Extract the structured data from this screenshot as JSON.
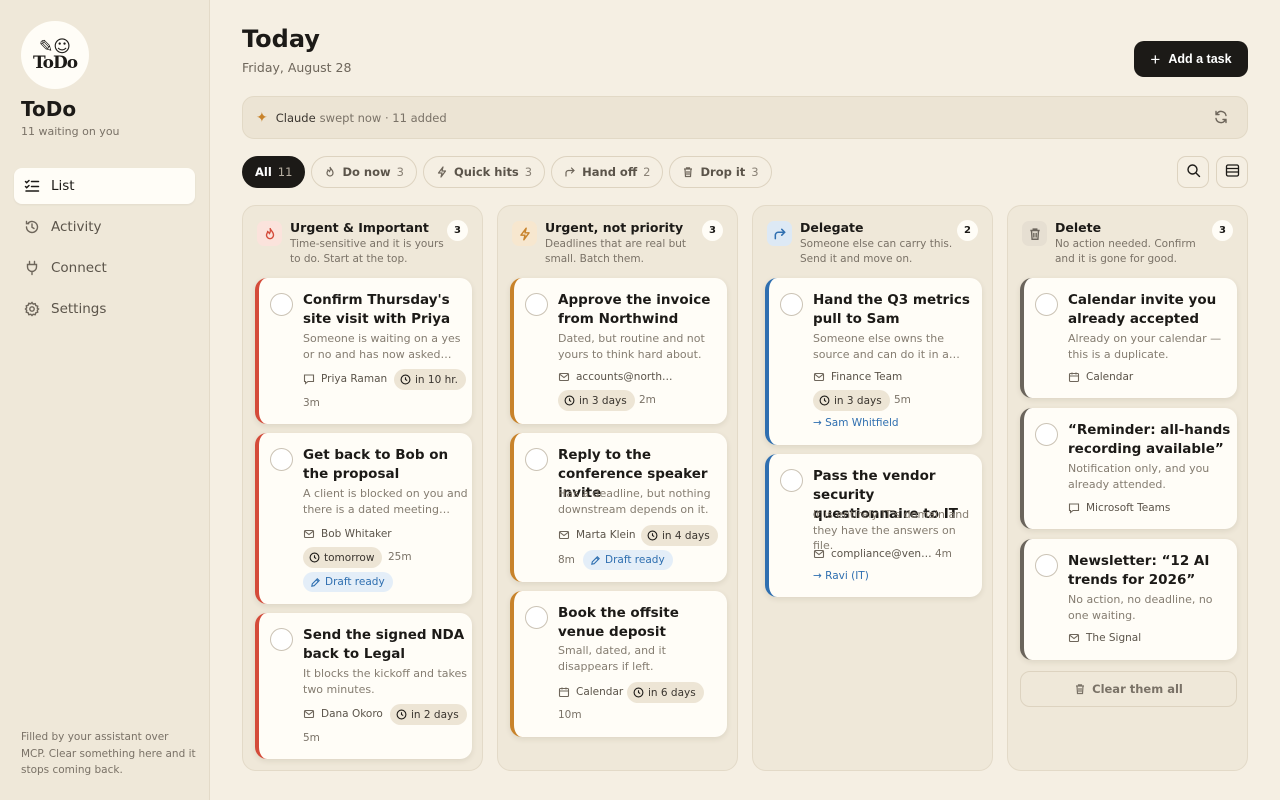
{
  "app": {
    "name": "ToDo",
    "subtitle": "11 waiting on you",
    "logo_text": "ToDo"
  },
  "nav": [
    {
      "label": "List",
      "icon": "list-check-icon",
      "active": true
    },
    {
      "label": "Activity",
      "icon": "history-icon",
      "active": false
    },
    {
      "label": "Connect",
      "icon": "plug-icon",
      "active": false
    },
    {
      "label": "Settings",
      "icon": "gear-icon",
      "active": false
    }
  ],
  "sidebar_footer": "Filled by your assistant over MCP. Clear something here and it stops coming back.",
  "header": {
    "title": "Today",
    "date": "Friday, August 28",
    "add_label": "Add a task"
  },
  "banner": {
    "who": "Claude",
    "text": "swept now · 11 added"
  },
  "filters": [
    {
      "label": "All",
      "count": "11",
      "active": true
    },
    {
      "label": "Do now",
      "count": "3",
      "icon": "flame-icon"
    },
    {
      "label": "Quick hits",
      "count": "3",
      "icon": "bolt-icon"
    },
    {
      "label": "Hand off",
      "count": "2",
      "icon": "forward-arrow-icon"
    },
    {
      "label": "Drop it",
      "count": "3",
      "icon": "trash-icon"
    }
  ],
  "columns": [
    {
      "title": "Urgent & Important",
      "count": "3",
      "accent": "#d44b3a",
      "desc": "Time-sensitive and it is yours to do. Start at the top.",
      "cards": [
        {
          "title": "Confirm Thursday's site visit with Priya",
          "desc": "Someone is waiting on a yes or no and has now asked…",
          "source": "Priya Raman",
          "source_icon": "chat-icon",
          "due": "in 10 hr.",
          "est": "3m"
        },
        {
          "title": "Get back to Bob on the proposal",
          "desc": "A client is blocked on you and there is a dated meeting…",
          "source": "Bob Whitaker",
          "source_icon": "mail-icon",
          "due": "tomorrow",
          "est": "25m",
          "draft": "Draft ready"
        },
        {
          "title": "Send the signed NDA back to Legal",
          "desc": "It blocks the kickoff and takes two minutes.",
          "source": "Dana Okoro",
          "source_icon": "mail-icon",
          "due": "in 2 days",
          "est": "5m"
        }
      ]
    },
    {
      "title": "Urgent, not priority",
      "count": "3",
      "accent": "#c8832b",
      "desc": "Deadlines that are real but small. Batch them.",
      "cards": [
        {
          "title": "Approve the invoice from Northwind",
          "desc": "Dated, but routine and not yours to think hard about.",
          "source": "accounts@north…",
          "source_icon": "mail-icon",
          "due": "in 3 days",
          "est": "2m"
        },
        {
          "title": "Reply to the conference speaker invite",
          "desc": "Has a deadline, but nothing downstream depends on it.",
          "source": "Marta Klein",
          "source_icon": "mail-icon",
          "due": "in 4 days",
          "est": "8m",
          "draft": "Draft ready"
        },
        {
          "title": "Book the offsite venue deposit",
          "desc": "Small, dated, and it disappears if left.",
          "source": "Calendar",
          "source_icon": "calendar-icon",
          "due": "in 6 days",
          "est": "10m"
        }
      ]
    },
    {
      "title": "Delegate",
      "count": "2",
      "accent": "#2f6fb0",
      "desc": "Someone else can carry this. Send it and move on.",
      "cards": [
        {
          "title": "Hand the Q3 metrics pull to Sam",
          "desc": "Someone else owns the source and can do it in a…",
          "source": "Finance Team",
          "source_icon": "mail-icon",
          "due": "in 3 days",
          "est": "5m",
          "assignee": "→ Sam Whitfield"
        },
        {
          "title": "Pass the vendor security questionnaire to IT",
          "desc": "It is entirely IT's domain and they have the answers on file.",
          "source": "compliance@ven…",
          "source_icon": "mail-icon",
          "est": "4m",
          "assignee": "→ Ravi (IT)"
        }
      ]
    },
    {
      "title": "Delete",
      "count": "3",
      "accent": "#6b655c",
      "desc": "No action needed. Confirm and it is gone for good.",
      "cards": [
        {
          "title": "Calendar invite you already accepted",
          "desc": "Already on your calendar — this is a duplicate.",
          "source": "Calendar",
          "source_icon": "calendar-icon"
        },
        {
          "title": "“Reminder: all-hands recording available”",
          "desc": "Notification only, and you already attended.",
          "source": "Microsoft Teams",
          "source_icon": "chat-icon"
        },
        {
          "title": "Newsletter: “12 AI trends for 2026”",
          "desc": "No action, no deadline, no one waiting.",
          "source": "The Signal",
          "source_icon": "mail-icon"
        }
      ],
      "clear_label": "Clear them all"
    }
  ]
}
